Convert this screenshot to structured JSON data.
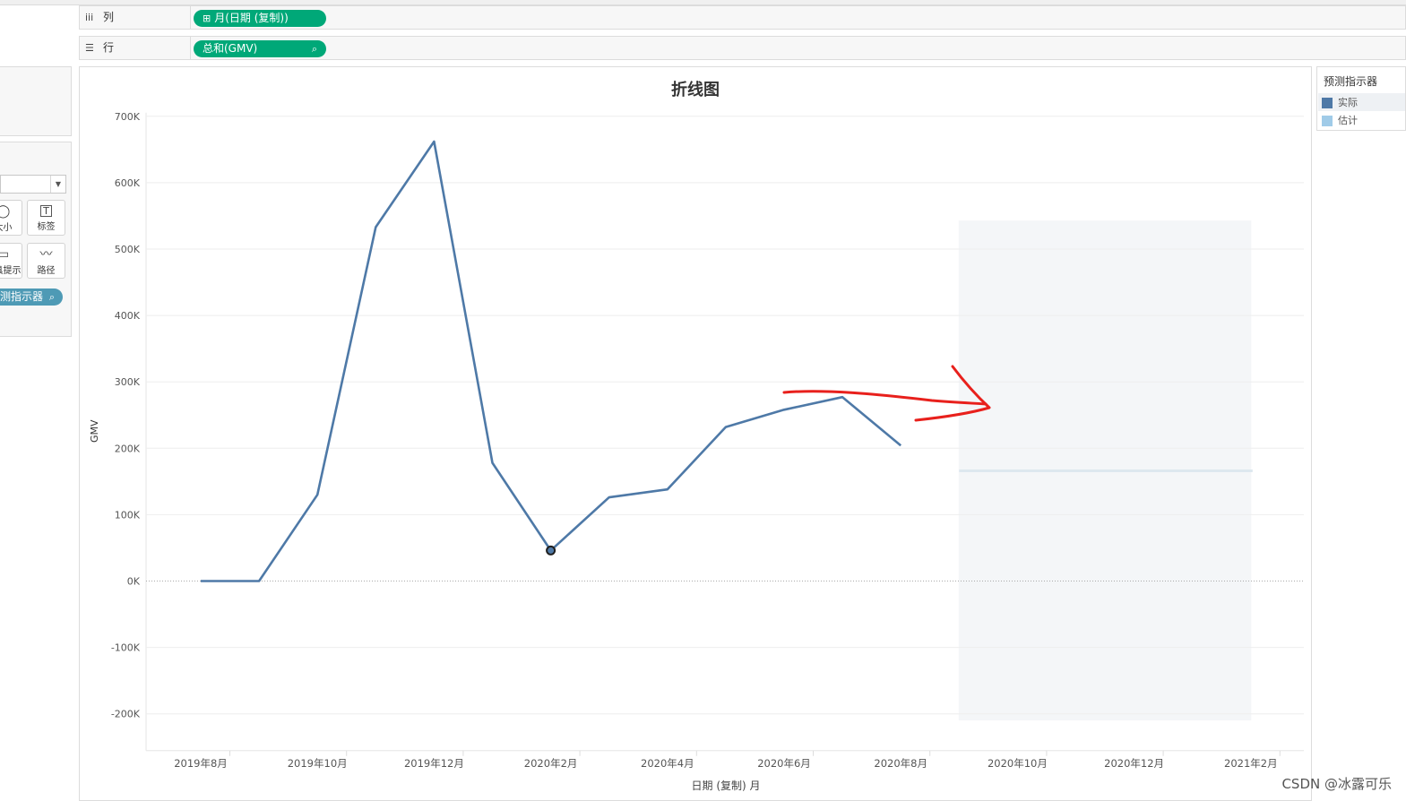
{
  "shelves": {
    "columns": {
      "icon": "iii",
      "label": "列",
      "pill": "月(日期 (复制))",
      "pill_icon": "⊞"
    },
    "rows": {
      "icon": "☰",
      "label": "行",
      "pill": "总和(GMV)",
      "pill_icon": "⌕"
    }
  },
  "marks": {
    "buttons": [
      {
        "icon": "size-icon",
        "glyph": "◯",
        "label": "大小"
      },
      {
        "icon": "label-icon",
        "glyph": "T",
        "label": "标签"
      },
      {
        "icon": "tooltip-icon",
        "glyph": "▭",
        "label": "工具提示"
      },
      {
        "icon": "path-icon",
        "glyph": "〰",
        "label": "路径"
      }
    ],
    "pill_label": "预测指示器",
    "pill_icon": "⌕"
  },
  "chart_data": {
    "type": "line",
    "title": "折线图",
    "xlabel": "日期 (复制) 月",
    "ylabel": "GMV",
    "ylim": [
      -250000,
      700000
    ],
    "y_ticks": [
      "700K",
      "600K",
      "500K",
      "400K",
      "300K",
      "200K",
      "100K",
      "0K",
      "-100K",
      "-200K"
    ],
    "y_tick_values": [
      700000,
      600000,
      500000,
      400000,
      300000,
      200000,
      100000,
      0,
      -100000,
      -200000
    ],
    "x_tick_labels": [
      "2019年8月",
      "2019年10月",
      "2019年12月",
      "2020年2月",
      "2020年4月",
      "2020年6月",
      "2020年8月",
      "2020年10月",
      "2020年12月",
      "2021年2月"
    ],
    "x_tick_months": [
      0,
      2,
      4,
      6,
      8,
      10,
      12,
      14,
      16,
      18
    ],
    "series": [
      {
        "name": "实际",
        "color": "#4e79a7",
        "x_months": [
          0,
          1,
          2,
          3,
          4,
          5,
          6,
          7,
          8,
          9,
          10,
          11,
          12
        ],
        "x": [
          "2019年8月",
          "2019年9月",
          "2019年10月",
          "2019年11月",
          "2019年12月",
          "2020年1月",
          "2020年2月",
          "2020年3月",
          "2020年4月",
          "2020年5月",
          "2020年6月",
          "2020年7月",
          "2020年8月"
        ],
        "values": [
          0,
          0,
          130000,
          533000,
          662000,
          178000,
          46000,
          126000,
          138000,
          232000,
          258000,
          277000,
          204000
        ]
      },
      {
        "name": "估计",
        "color": "#a0cbe8",
        "x_months": [
          13,
          18
        ],
        "x": [
          "2020年9月",
          "2021年2月"
        ],
        "values": [
          166000,
          166000
        ]
      }
    ],
    "highlight_point_month": 6,
    "forecast_band": {
      "start_month": 13,
      "end_month": 18,
      "upper": 543000,
      "lower": -210000
    },
    "grid": true,
    "zero_line": "dotted",
    "legend": {
      "title": "预测指示器",
      "position": "right",
      "items": [
        {
          "label": "实际",
          "color": "#4e79a7"
        },
        {
          "label": "估计",
          "color": "#a0cbe8"
        }
      ]
    },
    "annotation": {
      "type": "red hand-drawn arrow",
      "color": "#e8201c"
    }
  },
  "watermark": "CSDN @冰露可乐"
}
